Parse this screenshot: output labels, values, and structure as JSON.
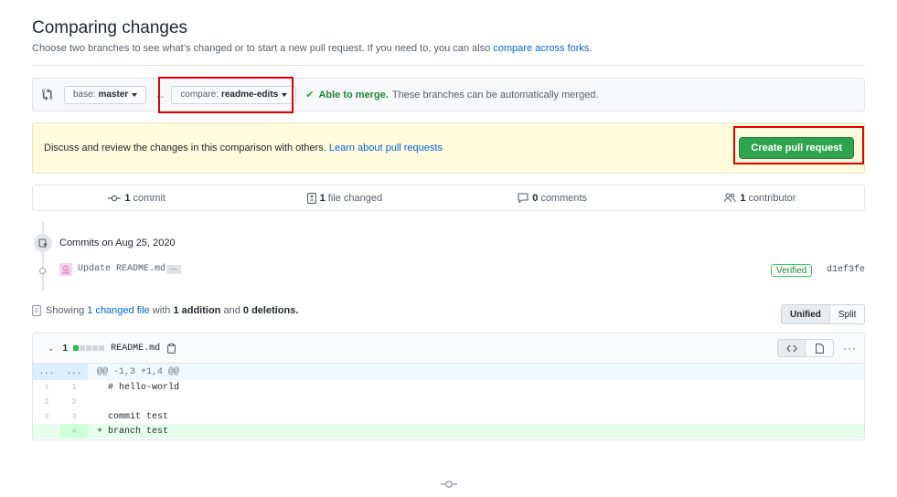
{
  "header": {
    "title": "Comparing changes",
    "subtitle_text": "Choose two branches to see what’s changed or to start a new pull request. If you need to, you can also",
    "subtitle_link": "compare across forks."
  },
  "range": {
    "base_prefix": "base:",
    "base_value": "master",
    "compare_prefix": "compare:",
    "compare_value": "readme-edits",
    "merge_ok": "Able to merge.",
    "merge_rest": "These branches can be automatically merged."
  },
  "flash": {
    "text": "Discuss and review the changes in this comparison with others.",
    "link": "Learn about pull requests",
    "button": "Create pull request"
  },
  "tabs": [
    {
      "count": "1",
      "label": "commit",
      "icon": "commit-icon"
    },
    {
      "count": "1",
      "label": "file changed",
      "icon": "file-diff-icon"
    },
    {
      "count": "0",
      "label": "comments",
      "icon": "comment-icon"
    },
    {
      "count": "1",
      "label": "contributor",
      "icon": "people-icon"
    }
  ],
  "commits": {
    "heading": "Commits on Aug 25, 2020",
    "items": [
      {
        "message": "Update README.md",
        "ellipsis": "…",
        "verified": "Verified",
        "sha": "d1ef3fe"
      }
    ]
  },
  "summary": {
    "showing": "Showing",
    "changed_link": "1 changed file",
    "with": "with",
    "additions": "1 addition",
    "and": "and",
    "deletions": "0 deletions."
  },
  "view_toggle": {
    "unified": "Unified",
    "split": "Split",
    "selected": "Unified"
  },
  "file": {
    "changes": "1",
    "name": "README.md",
    "hunk": "@@ -1,3 +1,4 @@",
    "hunk_left": "...",
    "hunk_right": "...",
    "lines": [
      {
        "old": "1",
        "new": "1",
        "text": "  # hello-world",
        "type": "context"
      },
      {
        "old": "2",
        "new": "2",
        "text": "",
        "type": "context"
      },
      {
        "old": "3",
        "new": "3",
        "text": "  commit test",
        "type": "context"
      },
      {
        "old": "",
        "new": "4",
        "text": "+ branch test",
        "type": "add"
      }
    ]
  },
  "colors": {
    "accent": "#0366d6",
    "merge_green": "#22863a",
    "button_green": "#2ea44f",
    "highlight": "#e00000"
  }
}
